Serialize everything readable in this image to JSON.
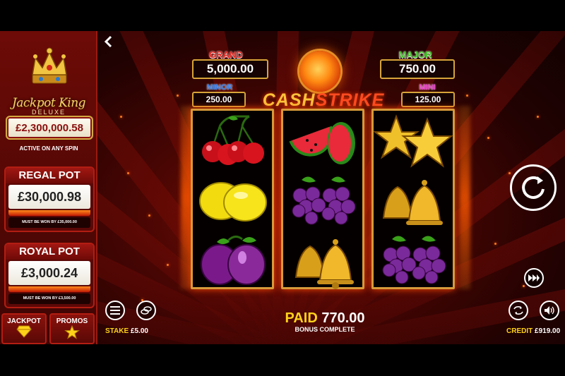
{
  "left_panel": {
    "logo_text": "Jackpot King",
    "logo_sub": "DELUXE",
    "jackpot_value": "£2,300,000.58",
    "active_text": "ACTIVE ON ANY SPIN",
    "regal_pot": {
      "title": "REGAL POT",
      "value": "£30,000.98",
      "note": "MUST BE WON BY £35,000.00"
    },
    "royal_pot": {
      "title": "ROYAL POT",
      "value": "£3,000.24",
      "note": "MUST BE WON BY £3,500.00"
    },
    "tabs": [
      {
        "label": "JACKPOT",
        "icon": "diamond-icon"
      },
      {
        "label": "PROMOS",
        "icon": "star-icon"
      }
    ]
  },
  "jackpots": {
    "grand": {
      "label": "GRAND",
      "value": "5,000.00",
      "color": "#e8251f"
    },
    "major": {
      "label": "MAJOR",
      "value": "750.00",
      "color": "#44c12c"
    },
    "minor": {
      "label": "MINOR",
      "value": "250.00",
      "color": "#2f7ef0"
    },
    "mini": {
      "label": "MINI",
      "value": "125.00",
      "color": "#e940c8"
    }
  },
  "title": {
    "part1": "CASH",
    "part2": "STRIKE"
  },
  "reels": [
    [
      "cherries",
      "lemons",
      "plums"
    ],
    [
      "watermelons",
      "grapes",
      "bells"
    ],
    [
      "stars",
      "bells",
      "grapes"
    ]
  ],
  "bottom": {
    "stake_label": "STAKE",
    "stake_value": "£5.00",
    "credit_label": "CREDIT",
    "credit_value": "£919.00",
    "paid_word": "PAID",
    "paid_value": "770.00",
    "status": "BONUS COMPLETE"
  },
  "controls": {
    "menu_icon": "menu-icon",
    "chips_icon": "coins-icon",
    "autoplay_icon": "autoplay-icon",
    "sound_icon": "speaker-icon",
    "turbo_icon": "fast-forward-icon",
    "spin_icon": "spin-icon"
  }
}
